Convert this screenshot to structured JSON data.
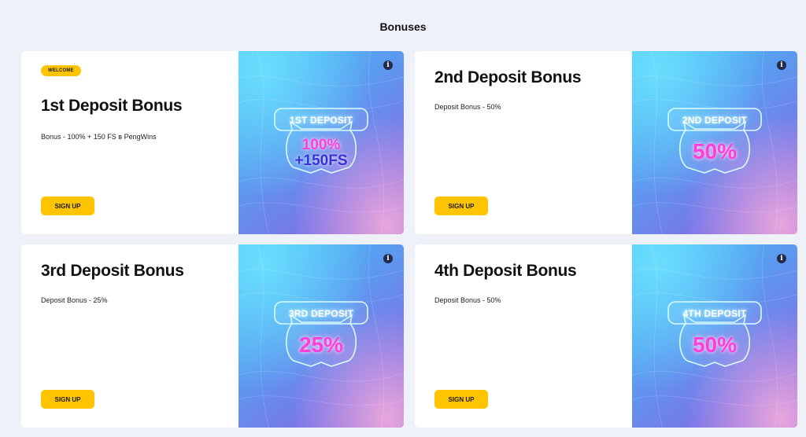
{
  "page": {
    "title": "Bonuses"
  },
  "cards": [
    {
      "badge": "WELCOME",
      "title": "1st Deposit Bonus",
      "description": "Bonus - 100% + 150 FS в PengWins",
      "button": "SIGN UP",
      "art": {
        "label": "1ST DEPOSIT",
        "value": "100%",
        "value_line2": "+150FS"
      },
      "info_icon": "info-icon"
    },
    {
      "title": "2nd Deposit Bonus",
      "description": "Deposit Bonus - 50%",
      "button": "SIGN UP",
      "art": {
        "label": "2ND DEPOSIT",
        "value": "50%"
      },
      "info_icon": "info-icon"
    },
    {
      "title": "3rd Deposit Bonus",
      "description": "Deposit Bonus - 25%",
      "button": "SIGN UP",
      "art": {
        "label": "3RD DEPOSIT",
        "value": "25%"
      },
      "info_icon": "info-icon"
    },
    {
      "title": "4th Deposit Bonus",
      "description": "Deposit Bonus - 50%",
      "button": "SIGN UP",
      "art": {
        "label": "4TH DEPOSIT",
        "value": "50%"
      },
      "info_icon": "info-icon"
    }
  ],
  "colors": {
    "background": "#eef1f8",
    "accent_yellow": "#ffc400",
    "value_pink": "#ff3fd8",
    "value_indigo": "#3a30d8"
  }
}
